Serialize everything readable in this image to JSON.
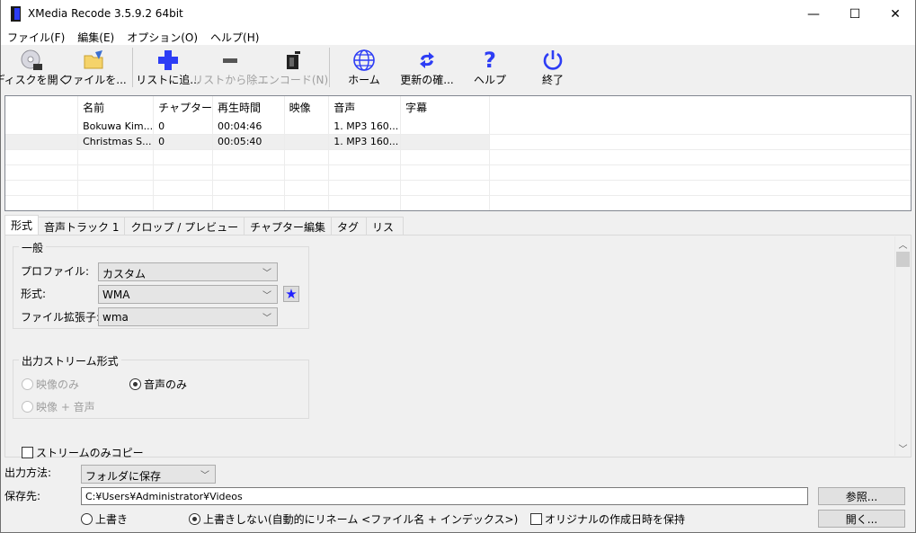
{
  "window": {
    "title": "XMedia Recode 3.5.9.2 64bit",
    "controls": {
      "minimize": "—",
      "maximize": "☐",
      "close": "✕"
    }
  },
  "menu": [
    {
      "label": "ファイル(F)"
    },
    {
      "label": "編集(E)"
    },
    {
      "label": "オプション(O)"
    },
    {
      "label": "ヘルプ(H)"
    }
  ],
  "toolbar": {
    "open_disc": {
      "label": "ディスクを開く",
      "icon": "disc-icon"
    },
    "open_file": {
      "label": "ファイルを...",
      "icon": "folder-icon"
    },
    "add_list": {
      "label": "リストに追...",
      "icon": "plus-icon"
    },
    "remove_list": {
      "label": "リストから除...",
      "icon": "minus-icon",
      "disabled": true
    },
    "encode": {
      "label": "エンコード(N)",
      "icon": "film-icon",
      "disabled": true
    },
    "home": {
      "label": "ホーム",
      "icon": "globe-icon"
    },
    "update": {
      "label": "更新の確...",
      "icon": "refresh-icon"
    },
    "help": {
      "label": "ヘルプ",
      "icon": "question-icon"
    },
    "exit": {
      "label": "終了",
      "icon": "power-icon"
    }
  },
  "file_list": {
    "columns": [
      "",
      "名前",
      "チャプター",
      "再生時間",
      "映像",
      "音声",
      "字幕"
    ],
    "rows": [
      {
        "name": "Bokuwa Kim...",
        "chapter": "0",
        "duration": "00:04:46",
        "video": "",
        "audio": "1. MP3 160...",
        "subtitle": "",
        "selected": false
      },
      {
        "name": "Christmas S...",
        "chapter": "0",
        "duration": "00:05:40",
        "video": "",
        "audio": "1. MP3 160...",
        "subtitle": "",
        "selected": true
      }
    ]
  },
  "tabs": [
    {
      "label": "形式",
      "active": true
    },
    {
      "label": "音声トラック 1"
    },
    {
      "label": "クロップ / プレビュー"
    },
    {
      "label": "チャプター編集"
    },
    {
      "label": "タグ"
    },
    {
      "label": "リスト"
    }
  ],
  "format_panel": {
    "general": {
      "title": "一般",
      "profile_label": "プロファイル:",
      "profile_value": "カスタム",
      "format_label": "形式:",
      "format_value": "WMA",
      "extension_label": "ファイル拡張子:",
      "extension_value": "wma"
    },
    "output_stream": {
      "title": "出力ストリーム形式",
      "video_only": "映像のみ",
      "audio_only": "音声のみ",
      "video_audio": "映像 + 音声",
      "selected": "audio_only"
    },
    "stream_copy_label": "ストリームのみコピー",
    "stream_copy_checked": false
  },
  "output": {
    "method_label": "出力方法:",
    "method_value": "フォルダに保存",
    "dest_label": "保存先:",
    "dest_value": "C:¥Users¥Administrator¥Videos",
    "browse_label": "参照...",
    "open_label": "開く...",
    "overwrite_label": "上書き",
    "no_overwrite_label": "上書きしない(自動的にリネーム <ファイル名 + インデックス>)",
    "keep_date_label": "オリジナルの作成日時を保持",
    "overwrite_selected": "no_overwrite",
    "keep_date_checked": false
  },
  "colors": {
    "accent_blue": "#2d3df5",
    "selected_row": "#efefef",
    "disabled_text": "#a0a0a0"
  }
}
